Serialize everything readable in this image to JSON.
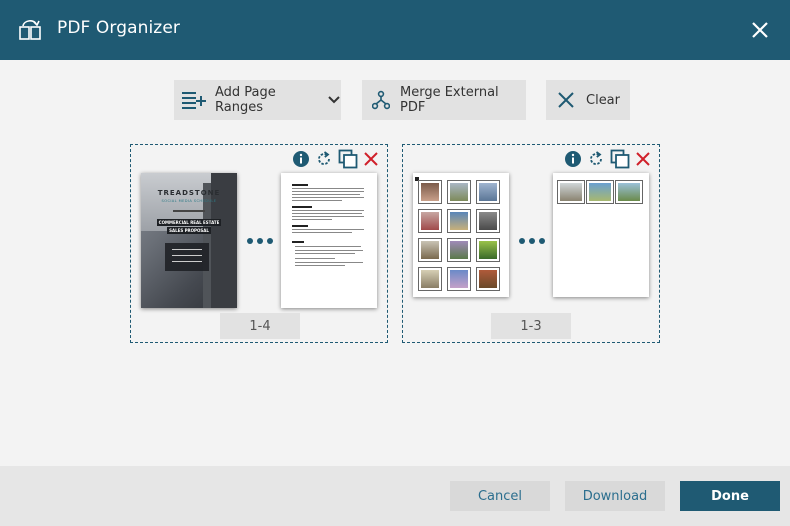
{
  "header": {
    "title": "PDF Organizer",
    "logo_icon": "pdf-organizer-logo-icon",
    "close_icon": "close-icon"
  },
  "toolbar": {
    "add_page_ranges": "Add Page Ranges",
    "merge_external_pdf": "Merge External PDF",
    "clear": "Clear"
  },
  "documents": [
    {
      "range": "1-4",
      "actions": [
        "info-icon",
        "rotate-icon",
        "duplicate-icon",
        "delete-icon"
      ],
      "cover": {
        "brand": "TREADSTONE",
        "subtitle": "SOCIAL MEDIA SCHEDULE",
        "headline_1": "COMMERCIAL REAL ESTATE",
        "headline_2": "SALES PROPOSAL"
      }
    },
    {
      "range": "1-3",
      "actions": [
        "info-icon",
        "rotate-icon",
        "duplicate-icon",
        "delete-icon"
      ]
    }
  ],
  "footer": {
    "cancel": "Cancel",
    "download": "Download",
    "done": "Done"
  },
  "colors": {
    "primary": "#1f5a73",
    "danger": "#d0202a",
    "button_bg": "#e2e2e2"
  }
}
